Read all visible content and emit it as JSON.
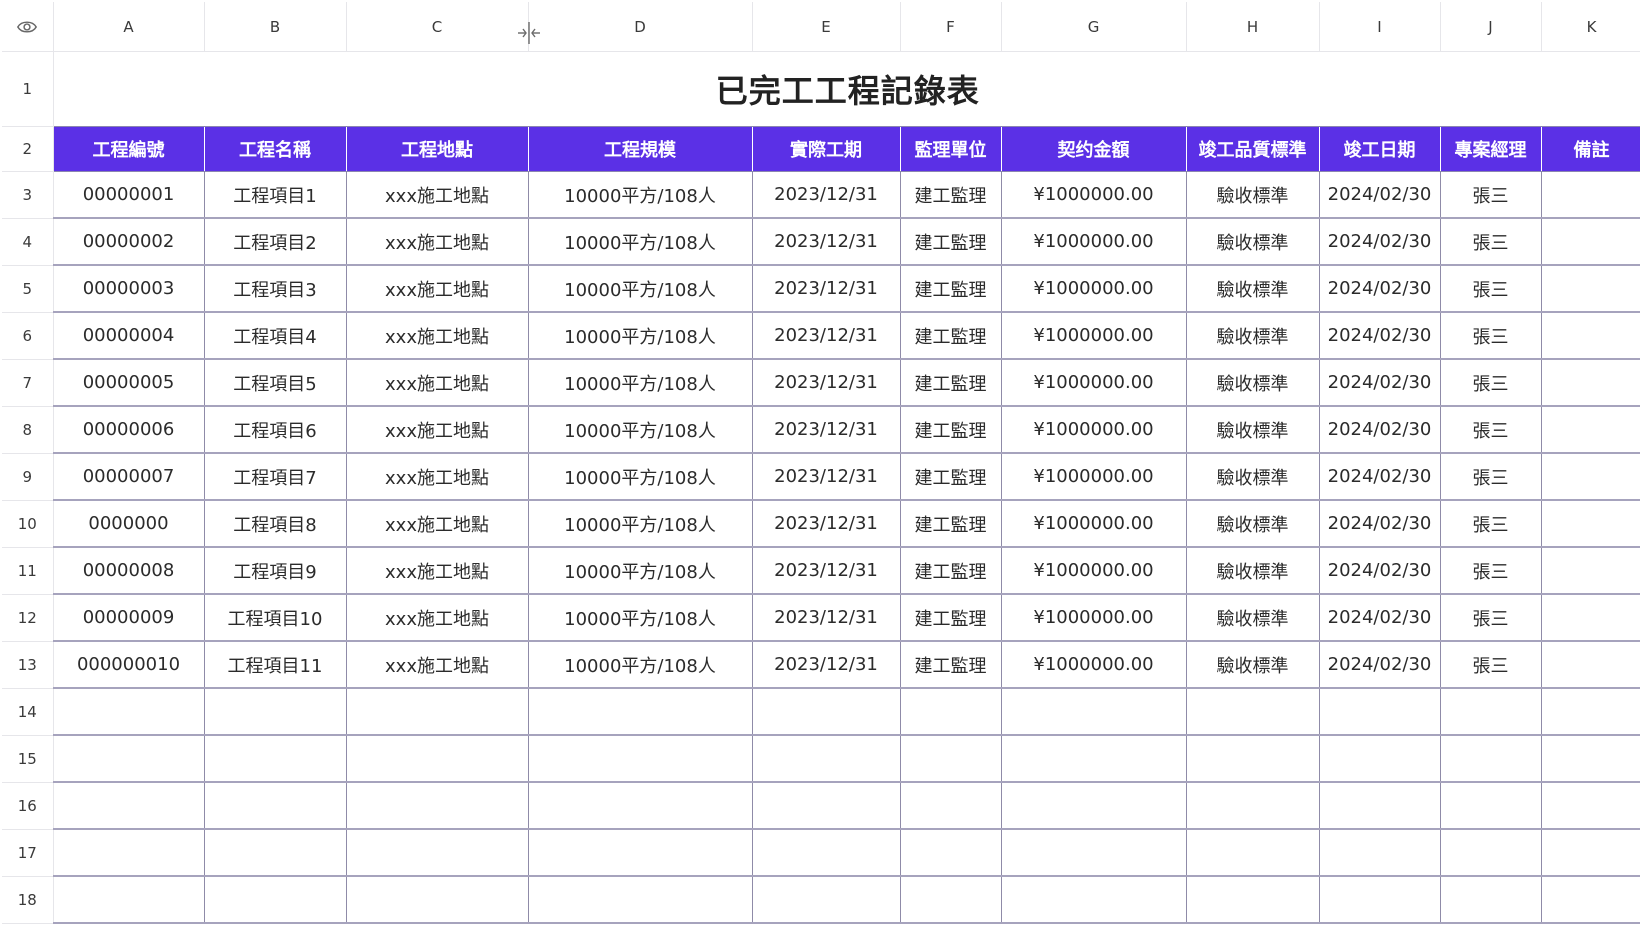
{
  "sheet": {
    "title": "已完工工程記錄表",
    "accent_color": "#5b30e6",
    "corner_icon": "eye-icon",
    "resize_icon": "column-resize-icon",
    "column_letters": [
      "A",
      "B",
      "C",
      "D",
      "E",
      "F",
      "G",
      "H",
      "I",
      "J",
      "K"
    ],
    "row_numbers": [
      "1",
      "2",
      "3",
      "4",
      "5",
      "6",
      "7",
      "8",
      "9",
      "10",
      "11",
      "12",
      "13",
      "14",
      "15",
      "16",
      "17",
      "18"
    ],
    "headers": [
      "工程編號",
      "工程名稱",
      "工程地點",
      "工程規模",
      "實際工期",
      "監理單位",
      "契约金額",
      "竣工品質標準",
      "竣工日期",
      "專案經理",
      "備註"
    ],
    "rows": [
      [
        "00000001",
        "工程項目1",
        "xxx施工地點",
        "10000平方/108人",
        "2023/12/31",
        "建工監理",
        "¥1000000.00",
        "驗收標準",
        "2024/02/30",
        "張三",
        ""
      ],
      [
        "00000002",
        "工程項目2",
        "xxx施工地點",
        "10000平方/108人",
        "2023/12/31",
        "建工監理",
        "¥1000000.00",
        "驗收標準",
        "2024/02/30",
        "張三",
        ""
      ],
      [
        "00000003",
        "工程項目3",
        "xxx施工地點",
        "10000平方/108人",
        "2023/12/31",
        "建工監理",
        "¥1000000.00",
        "驗收標準",
        "2024/02/30",
        "張三",
        ""
      ],
      [
        "00000004",
        "工程項目4",
        "xxx施工地點",
        "10000平方/108人",
        "2023/12/31",
        "建工監理",
        "¥1000000.00",
        "驗收標準",
        "2024/02/30",
        "張三",
        ""
      ],
      [
        "00000005",
        "工程項目5",
        "xxx施工地點",
        "10000平方/108人",
        "2023/12/31",
        "建工監理",
        "¥1000000.00",
        "驗收標準",
        "2024/02/30",
        "張三",
        ""
      ],
      [
        "00000006",
        "工程項目6",
        "xxx施工地點",
        "10000平方/108人",
        "2023/12/31",
        "建工監理",
        "¥1000000.00",
        "驗收標準",
        "2024/02/30",
        "張三",
        ""
      ],
      [
        "00000007",
        "工程項目7",
        "xxx施工地點",
        "10000平方/108人",
        "2023/12/31",
        "建工監理",
        "¥1000000.00",
        "驗收標準",
        "2024/02/30",
        "張三",
        ""
      ],
      [
        "0000000",
        "工程項目8",
        "xxx施工地點",
        "10000平方/108人",
        "2023/12/31",
        "建工監理",
        "¥1000000.00",
        "驗收標準",
        "2024/02/30",
        "張三",
        ""
      ],
      [
        "00000008",
        "工程項目9",
        "xxx施工地點",
        "10000平方/108人",
        "2023/12/31",
        "建工監理",
        "¥1000000.00",
        "驗收標準",
        "2024/02/30",
        "張三",
        ""
      ],
      [
        "00000009",
        "工程項目10",
        "xxx施工地點",
        "10000平方/108人",
        "2023/12/31",
        "建工監理",
        "¥1000000.00",
        "驗收標準",
        "2024/02/30",
        "張三",
        ""
      ],
      [
        "000000010",
        "工程項目11",
        "xxx施工地點",
        "10000平方/108人",
        "2023/12/31",
        "建工監理",
        "¥1000000.00",
        "驗收標準",
        "2024/02/30",
        "張三",
        ""
      ],
      [
        "",
        "",
        "",
        "",
        "",
        "",
        "",
        "",
        "",
        "",
        ""
      ],
      [
        "",
        "",
        "",
        "",
        "",
        "",
        "",
        "",
        "",
        "",
        ""
      ],
      [
        "",
        "",
        "",
        "",
        "",
        "",
        "",
        "",
        "",
        "",
        ""
      ],
      [
        "",
        "",
        "",
        "",
        "",
        "",
        "",
        "",
        "",
        "",
        ""
      ],
      [
        "",
        "",
        "",
        "",
        "",
        "",
        "",
        "",
        "",
        "",
        ""
      ]
    ]
  }
}
